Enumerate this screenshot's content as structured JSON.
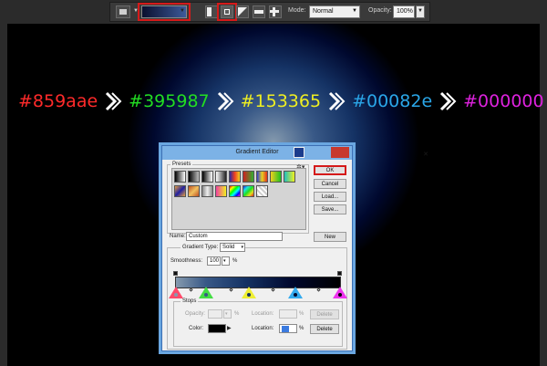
{
  "options_bar": {
    "icons": {
      "tool_preset": "gradient-tool-preset-icon",
      "linear": "linear-gradient-icon",
      "radial": "radial-gradient-icon",
      "angle": "angle-gradient-icon",
      "reflected": "reflected-gradient-icon",
      "diamond": "diamond-gradient-icon",
      "dropdown": "chevron-down-icon"
    },
    "mode_label": "Mode:",
    "mode_value": "Normal",
    "opacity_label": "Opacity:",
    "opacity_value": "100%"
  },
  "canvas": {
    "colors": [
      {
        "label": "#859aae",
        "text_color": "#ff2a2a"
      },
      {
        "label": "#395987",
        "text_color": "#22dd22"
      },
      {
        "label": "#153365",
        "text_color": "#eeee22"
      },
      {
        "label": "#00082e",
        "text_color": "#2aa6e8"
      },
      {
        "label": "#000000",
        "text_color": "#dd22dd"
      }
    ],
    "gradient_stops": [
      "#859aae",
      "#395987",
      "#153365",
      "#00082e",
      "#000000"
    ]
  },
  "dialog": {
    "title": "Gradient Editor",
    "close_label": "✕",
    "presets_label": "Presets",
    "buttons": {
      "ok": "OK",
      "cancel": "Cancel",
      "load": "Load...",
      "save": "Save...",
      "new": "New"
    },
    "name_label": "Name:",
    "name_value": "Custom",
    "gradient_type_label": "Gradient Type:",
    "gradient_type_value": "Solid",
    "smoothness_label": "Smoothness:",
    "smoothness_value": "100",
    "percent": "%",
    "stops_label": "Stops",
    "opacity_label": "Opacity:",
    "location_label": "Location:",
    "delete_label": "Delete",
    "color_label": "Color:",
    "color_value": "#000000",
    "location_value": "",
    "stop_markers": [
      {
        "color": "#ff4a6a",
        "fill": "#859aae"
      },
      {
        "color": "#44dd44",
        "fill": "#395987"
      },
      {
        "color": "#eeee33",
        "fill": "#153365"
      },
      {
        "color": "#33aaee",
        "fill": "#00082e"
      },
      {
        "color": "#ee33ee",
        "fill": "#000000"
      }
    ]
  }
}
